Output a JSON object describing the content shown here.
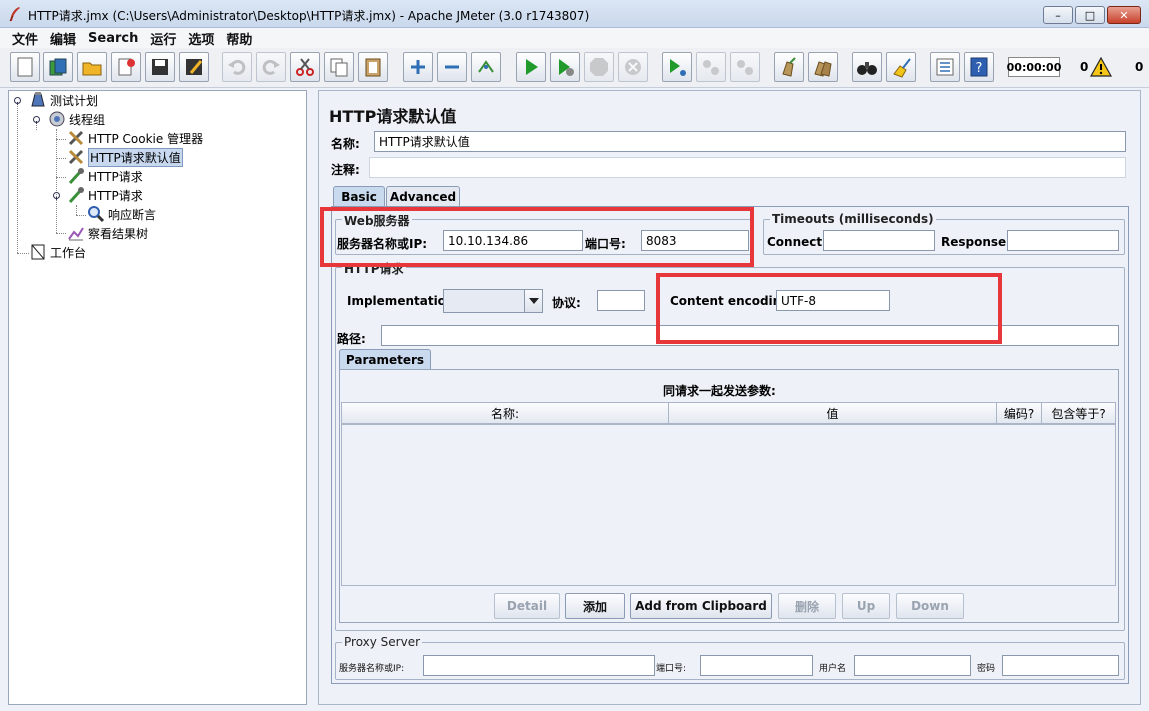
{
  "window": {
    "title": "HTTP请求.jmx (C:\\Users\\Administrator\\Desktop\\HTTP请求.jmx) - Apache JMeter (3.0 r1743807)",
    "min": "–",
    "max": "□",
    "close": "✕"
  },
  "menu": [
    "文件",
    "编辑",
    "Search",
    "运行",
    "选项",
    "帮助"
  ],
  "toolbar": {
    "timer": "00:00:00",
    "error_count": "0",
    "thread_count": "0"
  },
  "tree": {
    "items": [
      {
        "label": "测试计划",
        "icon": "test-plan-icon"
      },
      {
        "label": "线程组",
        "icon": "gear-icon"
      },
      {
        "label": "HTTP Cookie 管理器",
        "icon": "wrench-icon"
      },
      {
        "label": "HTTP请求默认值",
        "icon": "wrench-icon"
      },
      {
        "label": "HTTP请求",
        "icon": "pipette-icon"
      },
      {
        "label": "HTTP请求",
        "icon": "pipette-icon"
      },
      {
        "label": "响应断言",
        "icon": "magnifier-icon"
      },
      {
        "label": "察看结果树",
        "icon": "chart-icon"
      },
      {
        "label": "工作台",
        "icon": "workbench-icon"
      }
    ]
  },
  "panel": {
    "title": "HTTP请求默认值",
    "name_label": "名称:",
    "name_value": "HTTP请求默认值",
    "comment_label": "注释:",
    "comment_value": "",
    "tabs": [
      "Basic",
      "Advanced"
    ],
    "web_server": {
      "title": "Web服务器",
      "server_label": "服务器名称或IP:",
      "server_value": "10.10.134.86",
      "port_label": "端口号:",
      "port_value": "8083"
    },
    "timeouts": {
      "title": "Timeouts (milliseconds)",
      "connect_label": "Connect:",
      "connect_value": "",
      "response_label": "Response:",
      "response_value": ""
    },
    "http_request": {
      "title": "HTTP请求",
      "impl_label": "Implementation:",
      "impl_value": "",
      "protocol_label": "协议:",
      "protocol_value": "",
      "encoding_label": "Content encoding:",
      "encoding_value": "UTF-8",
      "path_label": "路径:",
      "path_value": ""
    },
    "parameters": {
      "tab": "Parameters",
      "caption": "同请求一起发送参数:",
      "columns": [
        "名称:",
        "值",
        "编码?",
        "包含等于?"
      ],
      "buttons": {
        "detail": "Detail",
        "add": "添加",
        "clipboard": "Add from Clipboard",
        "delete": "删除",
        "up": "Up",
        "down": "Down"
      }
    },
    "proxy": {
      "title": "Proxy Server",
      "server_label": "服务器名称或IP:",
      "port_label": "端口号:",
      "user_label": "用户名",
      "password_label": "密码"
    }
  },
  "colors": {
    "highlight_box": "#e8373a",
    "selection": "#c7d8ef",
    "panel_bg": "#eef2f8"
  }
}
